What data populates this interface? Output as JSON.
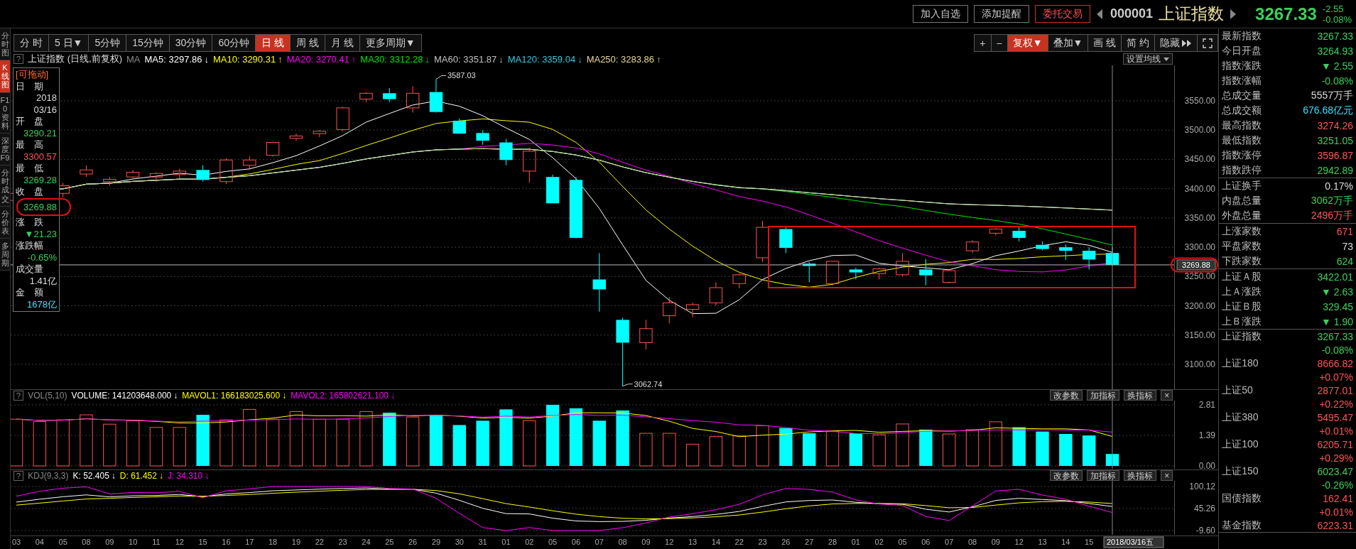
{
  "top_bar": {
    "buttons": [
      {
        "label": "加入自选",
        "kind": "plain"
      },
      {
        "label": "添加提醒",
        "kind": "plain"
      },
      {
        "label": "委托交易",
        "kind": "accent"
      }
    ],
    "code": "000001",
    "name": "上证指数",
    "price": "3267.33",
    "change": "-2.55",
    "change_pct": "-0.08%"
  },
  "side_tabs": [
    {
      "label": "分时图",
      "selected": false
    },
    {
      "label": "K线图",
      "selected": true
    },
    {
      "label": "F10资料",
      "selected": false
    },
    {
      "label": "深度F9",
      "selected": false
    },
    {
      "label": "分时成交",
      "selected": false
    },
    {
      "label": "分价表",
      "selected": false
    },
    {
      "label": "多周期",
      "selected": false
    }
  ],
  "period_tabs": [
    {
      "label": "分 时",
      "selected": false
    },
    {
      "label": "5 日▼",
      "selected": false
    },
    {
      "label": "5分钟",
      "selected": false
    },
    {
      "label": "15分钟",
      "selected": false
    },
    {
      "label": "30分钟",
      "selected": false
    },
    {
      "label": "60分钟",
      "selected": false
    },
    {
      "label": "日 线",
      "selected": true
    },
    {
      "label": "周 线",
      "selected": false
    },
    {
      "label": "月 线",
      "selected": false
    },
    {
      "label": "更多周期▼",
      "selected": false
    }
  ],
  "tools": [
    {
      "label": "+",
      "kind": "text",
      "selected": false
    },
    {
      "label": "−",
      "kind": "text",
      "selected": false
    },
    {
      "label": "复权▼",
      "kind": "text",
      "selected": true
    },
    {
      "label": "叠加▼",
      "kind": "text",
      "selected": false
    },
    {
      "label": "画 线",
      "kind": "text",
      "selected": false
    },
    {
      "label": "简 约",
      "kind": "text",
      "selected": false
    },
    {
      "label": "隐藏",
      "kind": "hide",
      "selected": false
    },
    {
      "kind": "fullscreen",
      "selected": false
    }
  ],
  "legend": {
    "help": "?",
    "title": "上证指数 (日线,前复权)",
    "prefix": "MA",
    "setting": "设置均线"
  },
  "price_chart": {
    "ma_lines": [
      {
        "text": "MA5: 3297.86",
        "arrow": "↓",
        "color": "#ffffff"
      },
      {
        "text": "MA10: 3290.31",
        "arrow": "↑",
        "color": "#ffff00"
      },
      {
        "text": "MA20: 3270.41",
        "arrow": "↑",
        "color": "#ff00ff"
      },
      {
        "text": "MA30: 3312.28",
        "arrow": "↓",
        "color": "#00e600"
      },
      {
        "text": "MA60: 3351.87",
        "arrow": "↓",
        "color": "#c0c0c0"
      },
      {
        "text": "MA120: 3359.04",
        "arrow": "↓",
        "color": "#2fc8e0"
      },
      {
        "text": "MA250: 3283.86",
        "arrow": "↑",
        "color": "#e8d890"
      }
    ],
    "yticks": [
      "3550.00",
      "3500.00",
      "3450.00",
      "3400.00",
      "3350.00",
      "3300.00",
      "3250.00",
      "3200.00",
      "3150.00",
      "3100.00"
    ],
    "high_label": "3587.03",
    "low_label": "3062.74",
    "cursor_price": "3269.88"
  },
  "info_box": {
    "title": "[可拖动]",
    "rows": [
      {
        "label": "日　期",
        "values": [
          "2018",
          "03/16"
        ],
        "color": "#dddddd"
      },
      {
        "label": "开　盘",
        "values": [
          "3290.21"
        ],
        "color": "#3cd05a"
      },
      {
        "label": "最　高",
        "values": [
          "3300.57"
        ],
        "color": "#ff5555"
      },
      {
        "label": "最　低",
        "values": [
          "3269.28"
        ],
        "color": "#3cd05a"
      },
      {
        "label": "收　盘",
        "values": [
          "3269.88"
        ],
        "color": "#3cd05a"
      },
      {
        "label": "涨　跌",
        "values": [
          "▼21.23"
        ],
        "color": "#3cd05a"
      },
      {
        "label": "涨跌幅",
        "values": [
          "-0.65%"
        ],
        "color": "#3cd05a"
      },
      {
        "label": "成交量",
        "values": [
          "1.41亿"
        ],
        "color": "#dddddd"
      },
      {
        "label": "金　额",
        "values": [
          "1678亿"
        ],
        "color": "#40e0ff"
      }
    ]
  },
  "volume_pane": {
    "help": "?",
    "name": "VOL(5,10)",
    "items": [
      {
        "text": "VOLUME: 141203648.000",
        "arrow": "↓",
        "color": "#ffffff"
      },
      {
        "text": "MAVOL1: 166183025.600",
        "arrow": "↓",
        "color": "#ffff00"
      },
      {
        "text": "MAVOL2: 165802621.100",
        "arrow": "↓",
        "color": "#ff00ff"
      }
    ],
    "buttons": [
      "改参数",
      "加指标",
      "换指标"
    ],
    "close": "×",
    "yticks": [
      "2.81",
      "1.39",
      "0.00"
    ]
  },
  "kdj_pane": {
    "help": "?",
    "name": "KDJ(9,3,3)",
    "items": [
      {
        "text": "K: 52.405",
        "arrow": "↓",
        "color": "#ffffff"
      },
      {
        "text": "D: 61.452",
        "arrow": "↓",
        "color": "#ffff00"
      },
      {
        "text": "J: 34.310",
        "arrow": "↓",
        "color": "#ff00ff"
      }
    ],
    "buttons": [
      "改参数",
      "加指标",
      "换指标"
    ],
    "close": "×",
    "yticks": [
      "100.12",
      "45.26",
      "-9.60"
    ]
  },
  "dates": [
    "03",
    "04",
    "05",
    "08",
    "09",
    "10",
    "11",
    "12",
    "15",
    "16",
    "17",
    "18",
    "19",
    "22",
    "23",
    "24",
    "25",
    "26",
    "29",
    "30",
    "31",
    "01",
    "02",
    "05",
    "06",
    "07",
    "08",
    "09",
    "12",
    "13",
    "14",
    "22",
    "23",
    "26",
    "27",
    "28",
    "01",
    "02",
    "05",
    "06",
    "07",
    "08",
    "09",
    "12",
    "13",
    "14",
    "15",
    "2018/03/16五"
  ],
  "quote_panel": {
    "sections": [
      [
        {
          "label": "最新指数",
          "value": "3267.33",
          "color": "#3cd05a"
        },
        {
          "label": "今日开盘",
          "value": "3264.93",
          "color": "#3cd05a"
        },
        {
          "label": "指数涨跌",
          "value": "▼ 2.55",
          "color": "#3cd05a"
        },
        {
          "label": "指数涨幅",
          "value": "-0.08%",
          "color": "#3cd05a"
        },
        {
          "label": "总成交量",
          "value": "5557万手",
          "color": "#dddddd"
        },
        {
          "label": "总成交额",
          "value": "676.68亿元",
          "color": "#40e0ff"
        },
        {
          "label": "最高指数",
          "value": "3274.26",
          "color": "#ff5555"
        },
        {
          "label": "最低指数",
          "value": "3251.05",
          "color": "#3cd05a"
        },
        {
          "label": "指数涨停",
          "value": "3596.87",
          "color": "#ff5555"
        },
        {
          "label": "指数跌停",
          "value": "2942.89",
          "color": "#3cd05a"
        }
      ],
      [
        {
          "label": "上证换手",
          "value": "0.17%",
          "color": "#dddddd"
        },
        {
          "label": "内盘总量",
          "value": "3062万手",
          "color": "#3cd05a"
        },
        {
          "label": "外盘总量",
          "value": "2496万手",
          "color": "#ff5555"
        }
      ],
      [
        {
          "label": "上涨家数",
          "value": "671",
          "color": "#ff5555"
        },
        {
          "label": "平盘家数",
          "value": "73",
          "color": "#dddddd"
        },
        {
          "label": "下跌家数",
          "value": "624",
          "color": "#3cd05a"
        }
      ],
      [
        {
          "label": "上证Ａ股",
          "value": "3422.01",
          "color": "#3cd05a"
        },
        {
          "label": "上Ａ涨跌",
          "value": "▼ 2.63",
          "color": "#3cd05a"
        },
        {
          "label": "上证Ｂ股",
          "value": "329.45",
          "color": "#3cd05a"
        },
        {
          "label": "上Ｂ涨跌",
          "value": "▼ 1.90",
          "color": "#3cd05a"
        }
      ],
      [
        {
          "label": "上证指数",
          "value": "3267.33",
          "change": "-0.08%",
          "color": "#3cd05a"
        },
        {
          "label": "上证180",
          "value": "8666.82",
          "change": "+0.07%",
          "color": "#ff5555"
        },
        {
          "label": "上证50",
          "value": "2877.01",
          "change": "+0.22%",
          "color": "#ff5555"
        },
        {
          "label": "上证380",
          "value": "5495.47",
          "change": "+0.01%",
          "color": "#ff5555"
        },
        {
          "label": "上证100",
          "value": "6205.71",
          "change": "+0.29%",
          "color": "#ff5555"
        },
        {
          "label": "上证150",
          "value": "6023.47",
          "change": "-0.26%",
          "color": "#3cd05a"
        },
        {
          "label": "国债指数",
          "value": "162.41",
          "change": "+0.01%",
          "color": "#ff5555"
        },
        {
          "label": "基金指数",
          "value": "6223.31",
          "color": "#ff5555"
        }
      ]
    ]
  }
}
